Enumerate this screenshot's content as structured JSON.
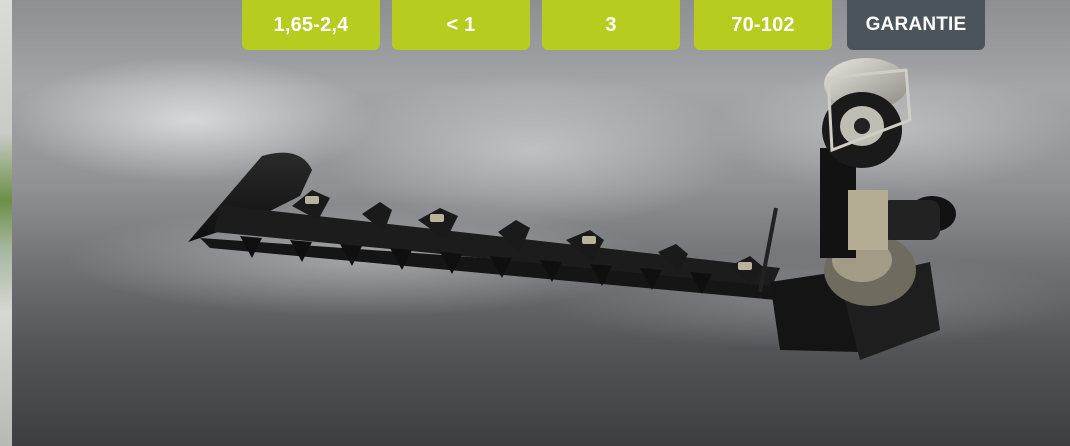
{
  "tabs": [
    {
      "label": "1,65-2,4",
      "color": "#b6cc1f"
    },
    {
      "label": "< 1",
      "color": "#b6cc1f"
    },
    {
      "label": "3",
      "color": "#b6cc1f"
    },
    {
      "label": "70-102",
      "color": "#b6cc1f"
    },
    {
      "label": "GARANTIE",
      "color": "#4a545a"
    }
  ],
  "hero": {
    "subject": "finger-bar-mower-product-image"
  }
}
